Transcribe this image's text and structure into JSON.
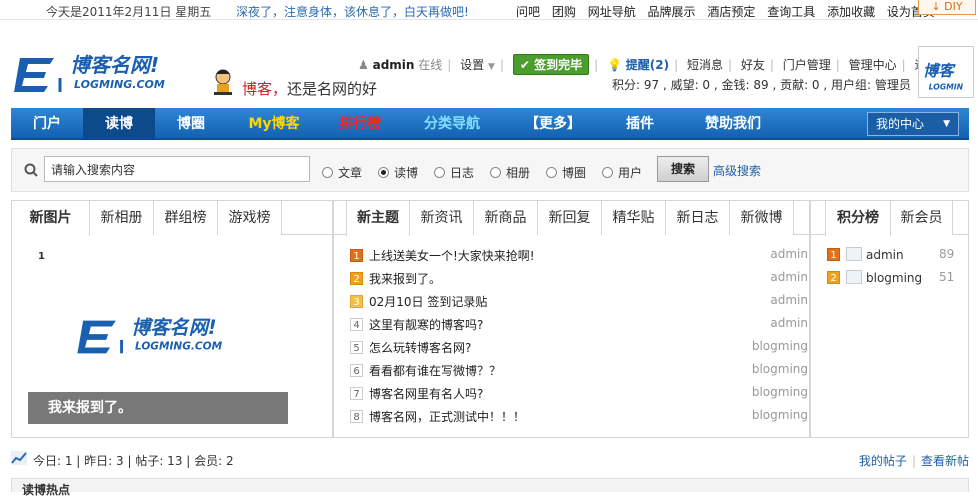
{
  "topbar": {
    "date": "今天是2011年2月11日 星期五",
    "tip": "深夜了，注意身体，该休息了，白天再做吧!",
    "links": [
      "问吧",
      "团购",
      "网址导航",
      "品牌展示",
      "酒店预定",
      "查询工具",
      "添加收藏",
      "设为首页"
    ],
    "diy": "DIY"
  },
  "header": {
    "slogan_red": "博客，",
    "slogan_rest": "还是名网的好",
    "username": "admin",
    "online": "在线",
    "settings": "设置",
    "checkin": "签到完毕",
    "remind": "提醒(2)",
    "links": [
      "短消息",
      "好友",
      "门户管理",
      "管理中心",
      "退出"
    ],
    "stats": "积分: 97 , 威望: 0 , 金钱: 89 , 贡献: 0 , 用户组: 管理员"
  },
  "nav": {
    "items": [
      {
        "label": "门户",
        "color": "#ffffff"
      },
      {
        "label": "读博",
        "color": "#ffffff"
      },
      {
        "label": "博圈",
        "color": "#ffffff"
      },
      {
        "label": "My博客",
        "color": "#ffd800"
      },
      {
        "label": "排行榜",
        "color": "#ff2020"
      },
      {
        "label": "分类导航",
        "color": "#7fe0ff"
      },
      {
        "label": "【更多】",
        "color": "#ffffff"
      },
      {
        "label": "插件",
        "color": "#ffffff"
      },
      {
        "label": "赞助我们",
        "color": "#ffffff"
      }
    ],
    "center": "我的中心"
  },
  "search": {
    "placeholder": "请输入搜索内容",
    "options": [
      {
        "label": "文章",
        "checked": false
      },
      {
        "label": "读博",
        "checked": true
      },
      {
        "label": "日志",
        "checked": false
      },
      {
        "label": "相册",
        "checked": false
      },
      {
        "label": "博圈",
        "checked": false
      },
      {
        "label": "用户",
        "checked": false
      }
    ],
    "button": "搜索",
    "advanced": "高级搜索"
  },
  "left_panel": {
    "tabs": [
      "新图片",
      "新相册",
      "群组榜",
      "游戏榜"
    ],
    "slide_index": "1",
    "caption": "我来报到了。"
  },
  "mid_panel": {
    "tabs": [
      "新主题",
      "新资讯",
      "新商品",
      "新回复",
      "精华贴",
      "新日志",
      "新微博"
    ],
    "topics": [
      {
        "n": "1",
        "title": "上线送美女一个!大家快来抢啊!",
        "author": "admin"
      },
      {
        "n": "2",
        "title": "我来报到了。",
        "author": "admin"
      },
      {
        "n": "3",
        "title": "02月10日 签到记录贴",
        "author": "admin"
      },
      {
        "n": "4",
        "title": "这里有靓寒的博客吗?",
        "author": "admin"
      },
      {
        "n": "5",
        "title": "怎么玩转博客名网?",
        "author": "blogming"
      },
      {
        "n": "6",
        "title": "看看都有谁在写微博？？",
        "author": "blogming"
      },
      {
        "n": "7",
        "title": "博客名网里有名人吗?",
        "author": "blogming"
      },
      {
        "n": "8",
        "title": "博客名网，正式测试中！！！",
        "author": "blogming"
      }
    ]
  },
  "right_panel": {
    "tabs": [
      "积分榜",
      "新会员"
    ],
    "ranks": [
      {
        "n": "1",
        "name": "admin",
        "value": "89"
      },
      {
        "n": "2",
        "name": "blogming",
        "value": "51"
      }
    ]
  },
  "footer": {
    "stats": "今日: 1  |  昨日: 3  |  帖子: 13  |  会员: 2",
    "my_posts": "我的帖子",
    "new_posts": "查看新帖"
  },
  "bottom": {
    "label": "读博热点"
  }
}
